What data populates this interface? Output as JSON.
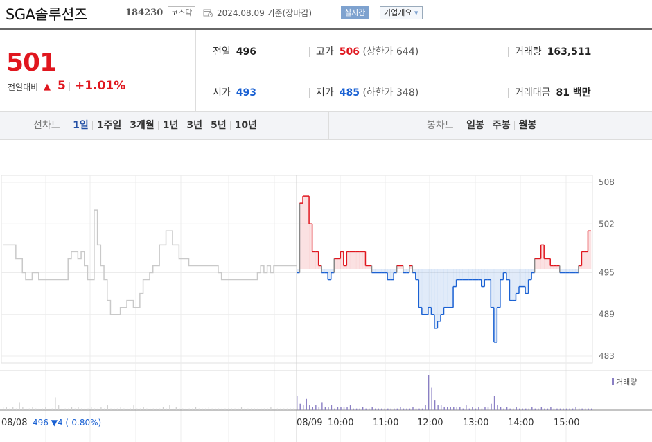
{
  "header": {
    "stock_name": "SGA솔루션즈",
    "stock_code": "184230",
    "market_badge": "코스닥",
    "date_text": "2024.08.09 기준(장마감)",
    "realtime_button": "실시간",
    "company_button": "기업개요",
    "company_button_arrow": "▾"
  },
  "price_box": {
    "current_price": "501",
    "change_label": "전일대비",
    "change_arrow": "▲",
    "change_value": "5",
    "change_percent": "+1.01%"
  },
  "info": {
    "prev_label": "전일",
    "prev_value": "496",
    "high_label": "고가",
    "high_value": "506",
    "upper_limit": "(상한가 644)",
    "volume_label": "거래량",
    "volume_value": "163,511",
    "open_label": "시가",
    "open_value": "493",
    "low_label": "저가",
    "low_value": "485",
    "lower_limit": "(하한가 348)",
    "amount_label": "거래대금",
    "amount_value": "81 백만"
  },
  "period_bar": {
    "line_chart_label": "선차트",
    "line_periods": [
      "1일",
      "1주일",
      "3개월",
      "1년",
      "3년",
      "5년",
      "10년"
    ],
    "active_period": "1일",
    "candle_chart_label": "봉차트",
    "candle_periods": [
      "일봉",
      "주봉",
      "월봉"
    ]
  },
  "colors": {
    "up": "#e0161e",
    "down": "#1a61d3",
    "accent": "#2450a5"
  },
  "chart_data": {
    "type": "line",
    "title": "",
    "y_ticks": [
      "508",
      "502",
      "495",
      "489",
      "483"
    ],
    "ylim": [
      482,
      509
    ],
    "baseline": 495.5,
    "x_ticks": [
      "08/09",
      "10:00",
      "11:00",
      "12:00",
      "13:00",
      "14:00",
      "15:00"
    ],
    "prev_day_label": "08/08",
    "prev_day_summary": "496 ▼4 (-0.80%)",
    "volume_legend": "거래량",
    "prev_day_series": [
      499,
      499,
      499,
      499,
      497,
      497,
      495,
      494,
      494,
      495,
      495,
      494,
      494,
      494,
      494,
      494,
      494,
      494,
      494,
      494,
      497,
      498,
      498,
      497,
      498,
      496,
      494,
      494,
      504,
      499,
      496,
      494,
      491,
      489,
      489,
      489,
      490,
      490,
      491,
      491,
      490,
      490,
      492,
      494,
      494,
      495,
      496,
      496,
      499,
      499,
      501,
      501,
      499,
      499,
      497,
      497,
      497,
      496,
      496,
      496,
      496,
      496,
      496,
      496,
      496,
      496,
      495,
      494,
      494,
      494,
      494,
      494,
      494,
      494,
      494,
      494,
      494,
      494,
      495,
      496,
      495,
      496,
      495,
      496,
      496,
      496,
      496,
      496,
      496,
      496,
      496
    ],
    "today_series": [
      495,
      505,
      506,
      506,
      502,
      498,
      498,
      496,
      495,
      495,
      494,
      495,
      497,
      497,
      498,
      496,
      498,
      498,
      498,
      498,
      498,
      498,
      496,
      496,
      495,
      495,
      495,
      495,
      495,
      494,
      494,
      495,
      496,
      496,
      495,
      495,
      496,
      495,
      494,
      490,
      489,
      489,
      490,
      489,
      487,
      488,
      489,
      490,
      490,
      490,
      493,
      494,
      494,
      494,
      494,
      494,
      494,
      494,
      494,
      493,
      494,
      494,
      490,
      485,
      490,
      494,
      495,
      494,
      491,
      491,
      492,
      493,
      493,
      492,
      494,
      495,
      497,
      497,
      499,
      497,
      497,
      496,
      496,
      496,
      495,
      495,
      495,
      495,
      495,
      495,
      496,
      498,
      498,
      501,
      501
    ],
    "volume_prev": [
      2,
      2,
      1,
      2,
      1,
      5,
      2,
      1,
      1,
      2,
      1,
      1,
      1,
      2,
      1,
      1,
      8,
      3,
      1,
      1,
      1,
      2,
      1,
      2,
      1,
      1,
      1,
      2,
      1,
      1,
      2,
      1,
      3,
      1,
      1,
      1,
      2,
      1,
      1,
      1,
      3,
      1,
      1,
      2,
      1,
      1,
      1,
      1,
      1,
      2,
      1,
      3,
      1,
      2,
      1,
      1,
      1,
      1,
      1,
      2,
      1,
      1,
      1,
      2,
      1,
      1,
      1,
      1,
      1,
      1,
      1,
      1,
      1,
      2,
      1,
      1,
      1,
      1,
      1,
      1,
      1,
      1,
      2,
      1,
      1,
      1,
      1,
      1,
      1,
      1,
      1
    ],
    "volume_today": [
      9,
      4,
      3,
      7,
      3,
      2,
      3,
      2,
      5,
      2,
      2,
      3,
      1,
      2,
      2,
      2,
      2,
      3,
      1,
      1,
      1,
      2,
      1,
      1,
      2,
      1,
      1,
      1,
      1,
      1,
      1,
      1,
      1,
      2,
      1,
      1,
      1,
      2,
      1,
      1,
      1,
      3,
      22,
      14,
      6,
      3,
      3,
      2,
      2,
      2,
      2,
      2,
      2,
      1,
      3,
      1,
      2,
      1,
      2,
      1,
      2,
      2,
      4,
      9,
      3,
      2,
      1,
      2,
      1,
      1,
      2,
      1,
      1,
      1,
      1,
      2,
      1,
      1,
      2,
      1,
      1,
      2,
      1,
      1,
      1,
      1,
      1,
      1,
      1,
      2,
      1,
      1,
      1,
      1,
      1
    ]
  }
}
